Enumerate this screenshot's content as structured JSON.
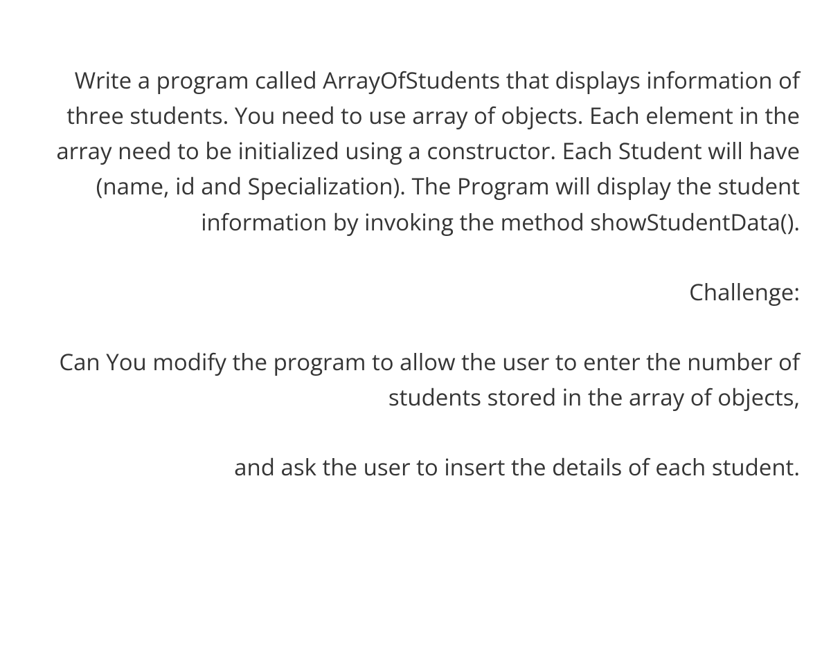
{
  "main": {
    "paragraph1": "Write a program called ArrayOfStudents that displays information of three students. You need to use array of objects. Each element in the array need to be initialized using a constructor. Each Student will have (name, id and Specialization).  The Program will display the student information by invoking the method showStudentData().",
    "challengeLabel": "Challenge:",
    "paragraph2": "Can You modify the program to allow the user to enter the number of students stored in the array of objects,",
    "paragraph3": "and ask the user to insert the details of each student."
  }
}
